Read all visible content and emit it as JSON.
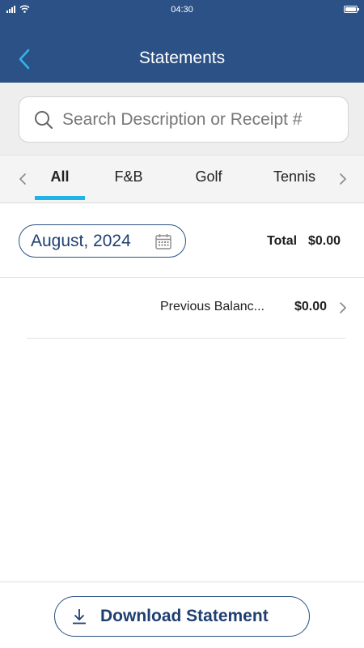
{
  "status_bar": {
    "time": "04:30",
    "battery_level": 0.9
  },
  "header": {
    "title": "Statements",
    "back_icon": "chevron-left-icon",
    "color": "#2b5186"
  },
  "search": {
    "placeholder": "Search Description or Receipt #",
    "value": ""
  },
  "tabs": {
    "items": [
      {
        "label": "All",
        "selected": true
      },
      {
        "label": "F&B",
        "selected": false
      },
      {
        "label": "Golf",
        "selected": false
      },
      {
        "label": "Tennis",
        "selected": false
      }
    ],
    "accent": "#1fb3e8"
  },
  "filter": {
    "month": "August, 2024",
    "total_label": "Total",
    "total_value": "$0.00"
  },
  "rows": [
    {
      "description": "Previous Balanc...",
      "amount": "$0.00"
    }
  ],
  "footer": {
    "download_label": "Download Statement"
  }
}
